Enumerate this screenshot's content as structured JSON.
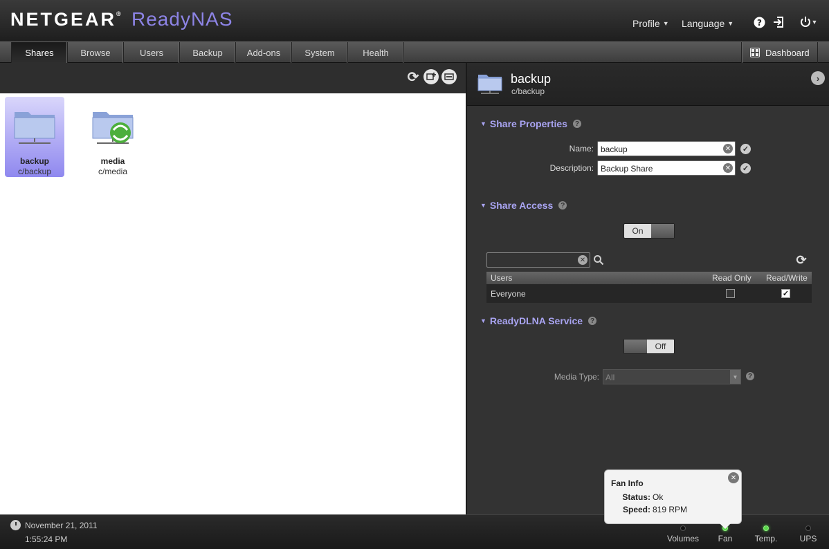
{
  "header": {
    "brand": "NETGEAR",
    "brand_mark": "®",
    "product": "ReadyNAS",
    "profile_label": "Profile",
    "language_label": "Language"
  },
  "nav": {
    "tabs": [
      {
        "label": "Shares",
        "active": true
      },
      {
        "label": "Browse"
      },
      {
        "label": "Users"
      },
      {
        "label": "Backup"
      },
      {
        "label": "Add-ons"
      },
      {
        "label": "System"
      },
      {
        "label": "Health"
      }
    ],
    "dashboard_label": "Dashboard"
  },
  "shares": [
    {
      "name": "backup",
      "path": "c/backup",
      "selected": true
    },
    {
      "name": "media",
      "path": "c/media",
      "selected": false
    }
  ],
  "detail": {
    "title": "backup",
    "subtitle": "c/backup",
    "share_properties": {
      "title": "Share Properties",
      "name_label": "Name:",
      "name_value": "backup",
      "description_label": "Description:",
      "description_value": "Backup Share"
    },
    "share_access": {
      "title": "Share Access",
      "toggle_label": "On",
      "search_value": "",
      "columns": [
        "Users",
        "Read Only",
        "Read/Write"
      ],
      "rows": [
        {
          "user": "Everyone",
          "read_only": false,
          "read_write": true
        }
      ]
    },
    "readydlna": {
      "title": "ReadyDLNA Service",
      "toggle_label": "Off",
      "media_type_label": "Media Type:",
      "media_type_value": "All"
    }
  },
  "footer": {
    "date": "November 21, 2011",
    "time": "1:55:24 PM",
    "status": [
      {
        "label": "Volumes",
        "led": "off"
      },
      {
        "label": "Fan",
        "led": "green"
      },
      {
        "label": "Temp.",
        "led": "green"
      },
      {
        "label": "UPS",
        "led": "off"
      }
    ]
  },
  "tooltip": {
    "title": "Fan Info",
    "status_label": "Status:",
    "status_value": "Ok",
    "speed_label": "Speed:",
    "speed_value": "819 RPM"
  },
  "colors": {
    "accent": "#a9a4f2",
    "brand_purple": "#8d84e6",
    "selection": "#8f88ef",
    "led_green": "#5bd84c"
  },
  "icons": [
    "help-icon",
    "logout-icon",
    "power-icon",
    "dashboard-icon",
    "refresh-icon",
    "add-share-icon",
    "share-settings-icon",
    "folder-icon",
    "clear-icon",
    "confirm-icon",
    "search-icon",
    "clock-icon",
    "close-icon",
    "forward-arrow-icon"
  ]
}
